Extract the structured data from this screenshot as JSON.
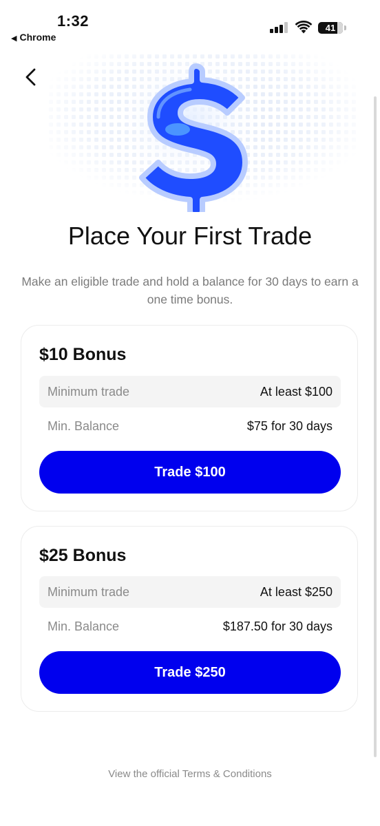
{
  "status_bar": {
    "time": "1:32",
    "back_app": "Chrome",
    "battery_level": "41"
  },
  "header": {
    "back_icon": "chevron-left-icon",
    "hero_icon": "dollar-sign-icon"
  },
  "main": {
    "title": "Place Your First Trade",
    "subtitle": "Make an eligible trade and hold a balance for 30 days to earn a one time bonus."
  },
  "bonuses": [
    {
      "title": "$10 Bonus",
      "rows": [
        {
          "label": "Minimum trade",
          "value": "At least $100"
        },
        {
          "label": "Min. Balance",
          "value": "$75 for 30 days"
        }
      ],
      "button_label": "Trade $100"
    },
    {
      "title": "$25 Bonus",
      "rows": [
        {
          "label": "Minimum trade",
          "value": "At least $250"
        },
        {
          "label": "Min. Balance",
          "value": "$187.50 for 30 days"
        }
      ],
      "button_label": "Trade $250"
    }
  ],
  "footer": {
    "terms_link": "View the official Terms & Conditions"
  },
  "colors": {
    "accent": "#0000ee",
    "text": "#111111",
    "muted": "#8a8a8a",
    "row_bg": "#f4f4f4",
    "card_border": "#ececec"
  }
}
